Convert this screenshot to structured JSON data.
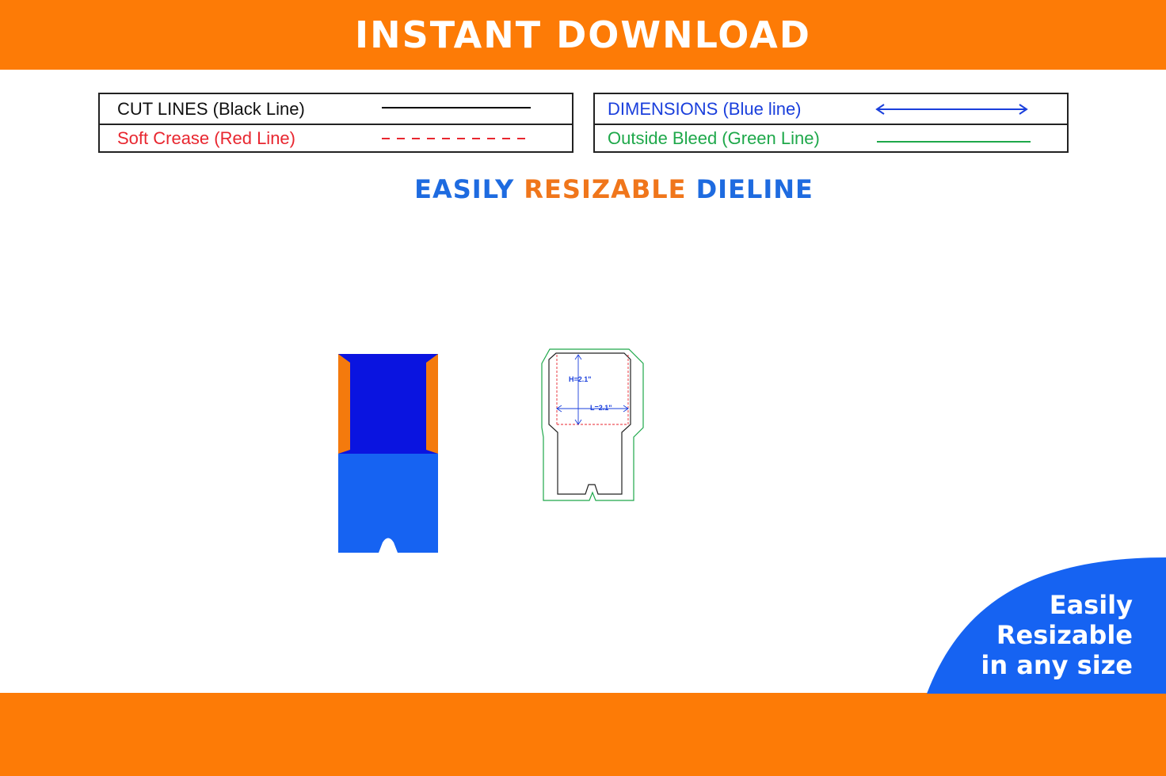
{
  "banner": {
    "title": "INSTANT DOWNLOAD"
  },
  "legend": {
    "cut_lines": "CUT LINES (Black Line)",
    "soft_crease": "Soft Crease (Red Line)",
    "dimensions": "DIMENSIONS (Blue line)",
    "outside_bleed": "Outside Bleed (Green Line)"
  },
  "subtitle": {
    "part1": "EASILY",
    "part2": "RESIZABLE",
    "part3": "DIELINE"
  },
  "dieline": {
    "height_label": "H=2.1\"",
    "length_label": "L=2.1\""
  },
  "badge": {
    "line1": "Easily",
    "line2": "Resizable",
    "line3": "in any size"
  },
  "colors": {
    "orange": "#fd7b06",
    "blue": "#1663f2",
    "dark_blue": "#0a14e0",
    "cut": "#000000",
    "crease": "#e8262f",
    "dimension": "#1a3fdc",
    "bleed": "#1ea84a"
  }
}
